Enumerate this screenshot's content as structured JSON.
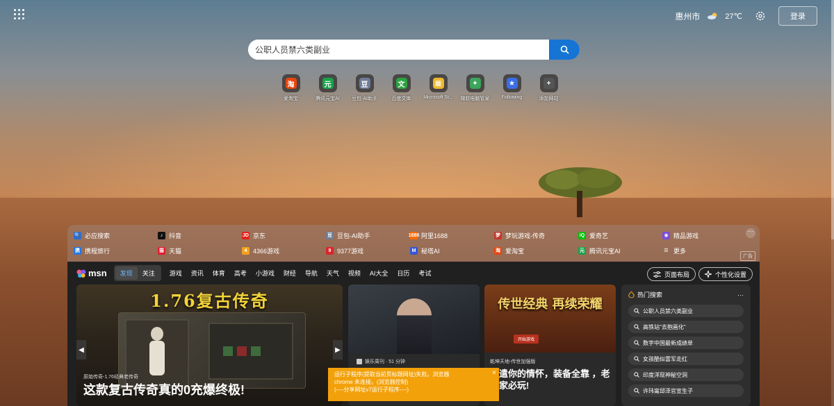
{
  "header": {
    "city": "惠州市",
    "temperature": "27℃",
    "login_label": "登录"
  },
  "search": {
    "placeholder": "公职人员禁六类副业"
  },
  "shortcuts": [
    {
      "label": "爱淘宝",
      "icon": "taobao-icon",
      "glyph": "淘",
      "color": "#e8450b"
    },
    {
      "label": "腾讯元宝AI",
      "icon": "yuanbao-icon",
      "glyph": "元",
      "color": "#19a34a"
    },
    {
      "label": "豆包-AI助手",
      "icon": "doubao-icon",
      "glyph": "豆",
      "color": "#6e7c96"
    },
    {
      "label": "百度文库",
      "icon": "wenku-icon",
      "glyph": "文",
      "color": "#2aa33f"
    },
    {
      "label": "Microsoft St...",
      "icon": "ms-store-icon",
      "glyph": "▦",
      "color": "#f1b82d"
    },
    {
      "label": "微软电脑管家",
      "icon": "pc-manager-icon",
      "glyph": "✦",
      "color": "#3ba55c"
    },
    {
      "label": "Following",
      "icon": "following-icon",
      "glyph": "★",
      "color": "#3a6de8"
    },
    {
      "label": "添加网站",
      "icon": "add-site-icon",
      "glyph": "+",
      "color": "#555555"
    }
  ],
  "quick_links": [
    {
      "label": "必应搜索",
      "icon": "bing-search-icon",
      "glyph": "🔍",
      "color": "#2f6ecf"
    },
    {
      "label": "抖音",
      "icon": "douyin-icon",
      "glyph": "♪",
      "color": "#111111"
    },
    {
      "label": "京东",
      "icon": "jd-icon",
      "glyph": "JD",
      "color": "#e2231a"
    },
    {
      "label": "豆包-AI助手",
      "icon": "doubao-icon",
      "glyph": "豆",
      "color": "#6e7c96"
    },
    {
      "label": "阿里1688",
      "icon": "alibaba-1688-icon",
      "glyph": "1688",
      "color": "#ff6a00"
    },
    {
      "label": "梦玩游戏-传奇",
      "icon": "game-legend-icon",
      "glyph": "梦",
      "color": "#c2372e"
    },
    {
      "label": "爱奇艺",
      "icon": "iqiyi-icon",
      "glyph": "iQ",
      "color": "#00be06"
    },
    {
      "label": "精品游戏",
      "icon": "game-controller-icon",
      "glyph": "◉",
      "color": "#7b4dd9"
    },
    {
      "label": "携程旅行",
      "icon": "ctrip-icon",
      "glyph": "携",
      "color": "#2577e3"
    },
    {
      "label": "天猫",
      "icon": "tmall-icon",
      "glyph": "猫",
      "color": "#e21b2e"
    },
    {
      "label": "4366游戏",
      "icon": "4366-game-icon",
      "glyph": "4",
      "color": "#f2a21d"
    },
    {
      "label": "9377游戏",
      "icon": "9377-game-icon",
      "glyph": "9",
      "color": "#d9262b"
    },
    {
      "label": "秘塔AI",
      "icon": "metaso-icon",
      "glyph": "M",
      "color": "#3557d6"
    },
    {
      "label": "爱淘宝",
      "icon": "taobao-icon",
      "glyph": "淘",
      "color": "#e8450b"
    },
    {
      "label": "腾讯元宝AI",
      "icon": "yuanbao-icon",
      "glyph": "元",
      "color": "#19a34a"
    },
    {
      "label": "更多",
      "icon": "more-menu-icon",
      "glyph": "☰",
      "color": "transparent"
    }
  ],
  "ad_label": "广告",
  "msn": {
    "logo": "msn",
    "tabs": [
      "发现",
      "关注"
    ],
    "nav": [
      "游戏",
      "资讯",
      "体育",
      "高考",
      "小游戏",
      "财经",
      "导航",
      "天气",
      "视频",
      "AI大全",
      "日历",
      "考试"
    ],
    "layout_button": "页面布局",
    "personalize_button": "个性化设置"
  },
  "hero": {
    "art_title": "1.76复古传奇",
    "source": "原始传奇-1.76经典老传奇",
    "headline": "这款复古传奇真的0充爆终极!"
  },
  "card2": {
    "source": "娱乐周刊 · 51 分钟"
  },
  "card3": {
    "art_title": "传世经典 再续荣耀",
    "art_button": "开始游戏",
    "source": "乾坤天地-传世加强版",
    "title": "消遣你的情怀，装备全靠 ，老玩家必玩!"
  },
  "hot_search": {
    "title": "热门搜索",
    "more": "···",
    "items": [
      "公职人员禁六类副业",
      "高铁站\"去抱画化\"",
      "数字中国最新成绩单",
      "女孩酷似雷军走红",
      "印度洋现神秘空洞",
      "许玮甯邱泽官宣生子"
    ]
  },
  "toast": {
    "line1": "运行子程序(提取当前页标题网址)失败。浏览器",
    "line2": "chrome 未连接。(浏览器控制)",
    "line3": "(----分享网址v7运行子程序----)",
    "close": "×"
  },
  "colors": {
    "accent": "#1574d4",
    "toast_bg": "#f3a10a",
    "msn_bg": "#202020"
  }
}
